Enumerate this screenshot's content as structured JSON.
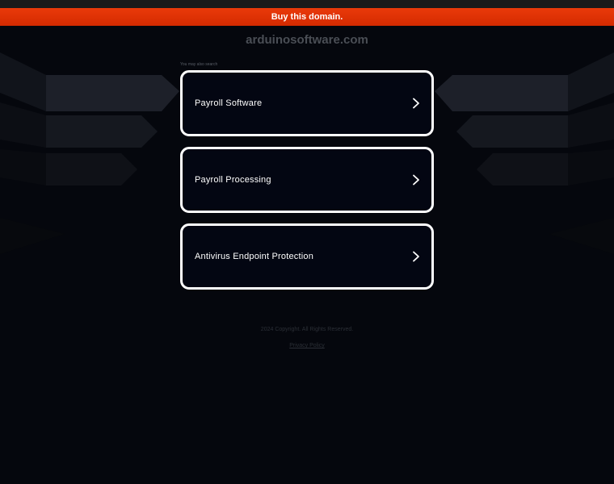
{
  "banner": {
    "buy_label": "Buy this domain."
  },
  "header": {
    "domain": "arduinosoftware.com"
  },
  "search": {
    "also_label": "You may also search",
    "items": [
      {
        "label": "Payroll Software"
      },
      {
        "label": "Payroll Processing"
      },
      {
        "label": "Antivirus Endpoint Protection"
      }
    ]
  },
  "footer": {
    "copyright": "2024 Copyright. All Rights Reserved.",
    "privacy": "Privacy Policy"
  },
  "colors": {
    "background": "#05070d",
    "banner": "#e03306",
    "card_border": "#ffffff",
    "card_fill": "#030612"
  },
  "icons": {
    "chevron": "chevron-right-icon"
  }
}
